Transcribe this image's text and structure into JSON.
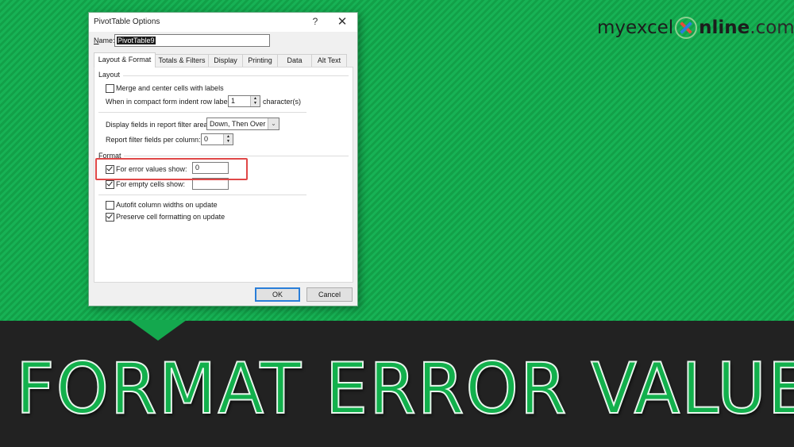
{
  "dialog": {
    "title": "PivotTable Options",
    "help_label": "?",
    "close_label": "✕",
    "name_label": "Name:",
    "name_value": "PivotTable9",
    "tabs": [
      {
        "label": "Layout & Format",
        "active": true
      },
      {
        "label": "Totals & Filters",
        "active": false
      },
      {
        "label": "Display",
        "active": false
      },
      {
        "label": "Printing",
        "active": false
      },
      {
        "label": "Data",
        "active": false
      },
      {
        "label": "Alt Text",
        "active": false
      }
    ],
    "layout_section": {
      "heading": "Layout",
      "merge_center_label": "Merge and center cells with labels",
      "merge_center_checked": false,
      "indent_label": "When in compact form indent row labels:",
      "indent_value": "1",
      "indent_unit": "character(s)",
      "filter_area_label": "Display fields in report filter area:",
      "filter_area_value": "Down, Then Over",
      "filter_fields_label": "Report filter fields per column:",
      "filter_fields_value": "0"
    },
    "format_section": {
      "heading": "Format",
      "error_values_label": "For error values show:",
      "error_values_checked": true,
      "error_values_value": "0",
      "empty_cells_label": "For empty cells show:",
      "empty_cells_checked": true,
      "empty_cells_value": "",
      "autofit_label": "Autofit column widths on update",
      "autofit_checked": false,
      "preserve_label": "Preserve cell formatting on update",
      "preserve_checked": true
    },
    "ok_label": "OK",
    "cancel_label": "Cancel"
  },
  "branding": {
    "logo_prefix": "myexcel",
    "logo_suffix": "nline",
    "logo_tld": ".com"
  },
  "banner": {
    "headline": "FORMAT ERROR VALUES"
  },
  "colors": {
    "brand_green": "#14a84e",
    "dark_band": "#222222",
    "highlight_red": "#e04848",
    "default_button_blue": "#2a7ed8"
  }
}
